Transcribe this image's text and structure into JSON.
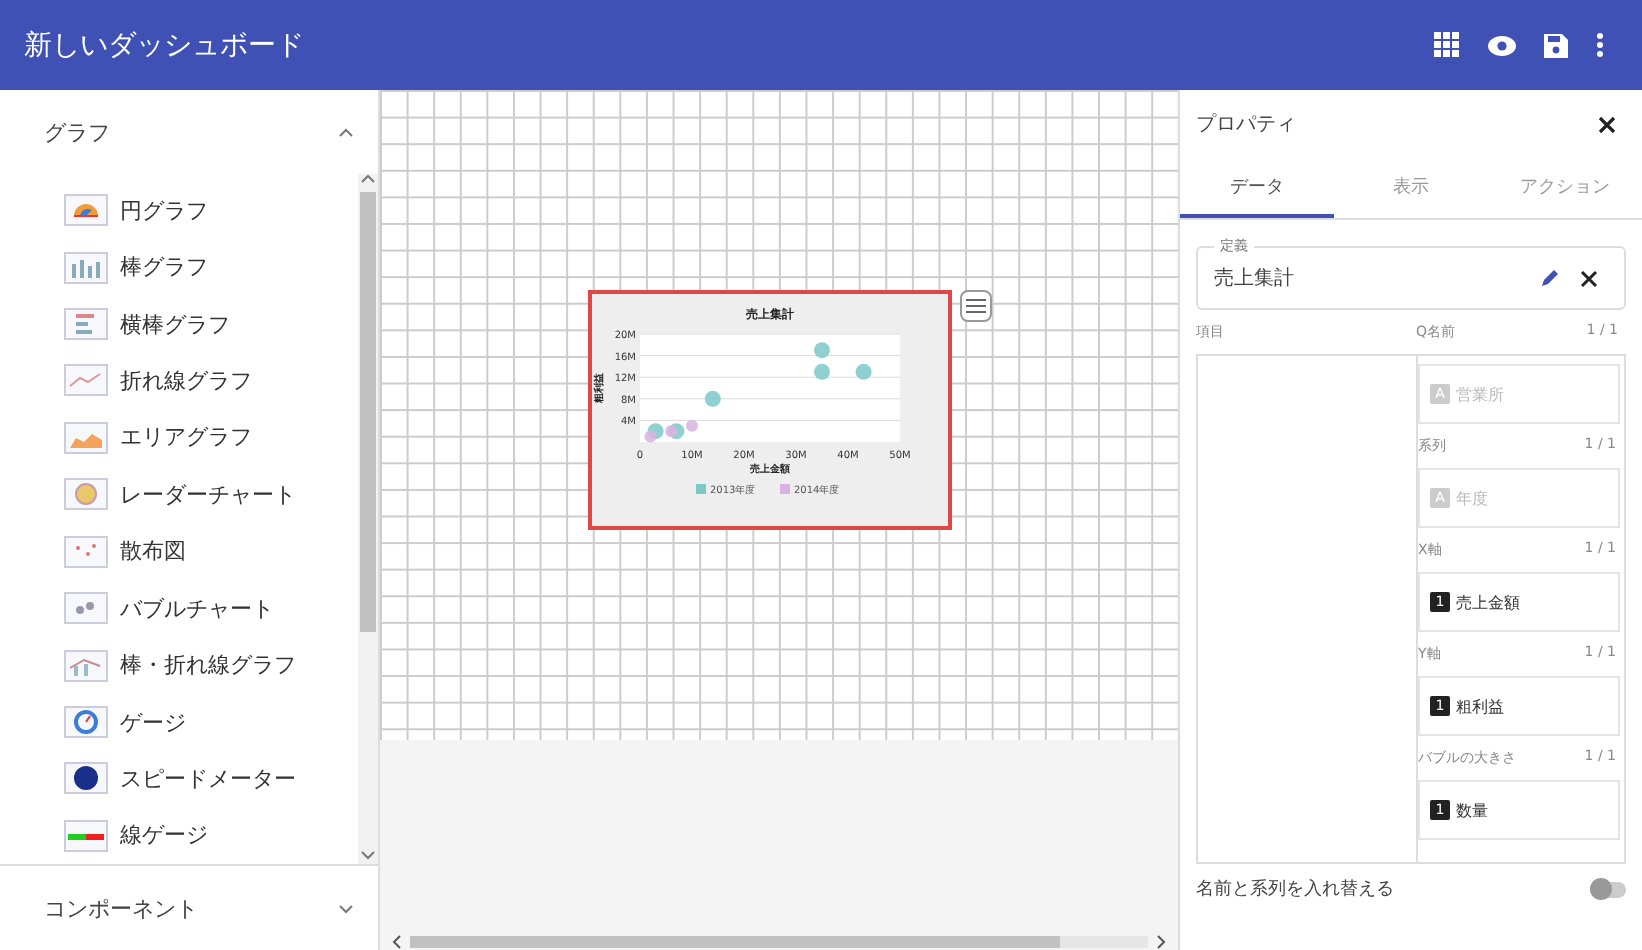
{
  "header": {
    "title": "新しいダッシュボード"
  },
  "sidebar": {
    "sections": [
      {
        "title": "グラフ",
        "expanded": true,
        "items": [
          {
            "label": "円グラフ"
          },
          {
            "label": "棒グラフ"
          },
          {
            "label": "横棒グラフ"
          },
          {
            "label": "折れ線グラフ"
          },
          {
            "label": "エリアグラフ"
          },
          {
            "label": "レーダーチャート"
          },
          {
            "label": "散布図"
          },
          {
            "label": "バブルチャート"
          },
          {
            "label": "棒・折れ線グラフ"
          },
          {
            "label": "ゲージ"
          },
          {
            "label": "スピードメーター"
          },
          {
            "label": "線ゲージ"
          }
        ]
      },
      {
        "title": "コンポーネント",
        "expanded": false
      }
    ]
  },
  "canvas": {
    "widget": {
      "selected": true,
      "chart_data": {
        "type": "scatter",
        "grid": true,
        "legend": "bottom",
        "title": "売上集計",
        "xlabel": "売上金額",
        "ylabel": "粗利益",
        "xlim": [
          0,
          50
        ],
        "ylim": [
          0,
          20
        ],
        "xticks": [
          {
            "value": 0,
            "label": "0"
          },
          {
            "value": 10,
            "label": "10M"
          },
          {
            "value": 20,
            "label": "20M"
          },
          {
            "value": 30,
            "label": "30M"
          },
          {
            "value": 40,
            "label": "40M"
          },
          {
            "value": 50,
            "label": "50M"
          }
        ],
        "yticks": [
          {
            "value": 4,
            "label": "4M"
          },
          {
            "value": 8,
            "label": "8M"
          },
          {
            "value": 12,
            "label": "12M"
          },
          {
            "value": 16,
            "label": "16M"
          },
          {
            "value": 20,
            "label": "20M"
          }
        ],
        "series": [
          {
            "name": "2013年度",
            "color": "#7ec8c8",
            "x": [
              35,
              35,
              43,
              14,
              3,
              7
            ],
            "values": [
              17,
              13,
              13,
              8,
              2,
              2
            ]
          },
          {
            "name": "2014年度",
            "color": "#d9b3e0",
            "x": [
              2,
              6,
              10
            ],
            "values": [
              1,
              2,
              3
            ]
          }
        ]
      }
    }
  },
  "properties": {
    "title": "プロパティ",
    "tabs": [
      {
        "label": "データ",
        "selected": true
      },
      {
        "label": "表示",
        "selected": false
      },
      {
        "label": "アクション",
        "selected": false
      }
    ],
    "definition": {
      "legend": "定義",
      "value": "売上集計"
    },
    "items_label": "項目",
    "slots": [
      {
        "label": "Q名前",
        "count": "1 / 1",
        "badge": "A",
        "value": "営業所",
        "filled": false
      },
      {
        "label": "系列",
        "count": "1 / 1",
        "badge": "A",
        "value": "年度",
        "filled": false
      },
      {
        "label": "X軸",
        "count": "1 / 1",
        "badge": "1",
        "value": "売上金額",
        "filled": true
      },
      {
        "label": "Y軸",
        "count": "1 / 1",
        "badge": "1",
        "value": "粗利益",
        "filled": true
      },
      {
        "label": "バブルの大きさ",
        "count": "1 / 1",
        "badge": "1",
        "value": "数量",
        "filled": true
      }
    ],
    "swap": {
      "label": "名前と系列を入れ替える",
      "on": false
    }
  }
}
